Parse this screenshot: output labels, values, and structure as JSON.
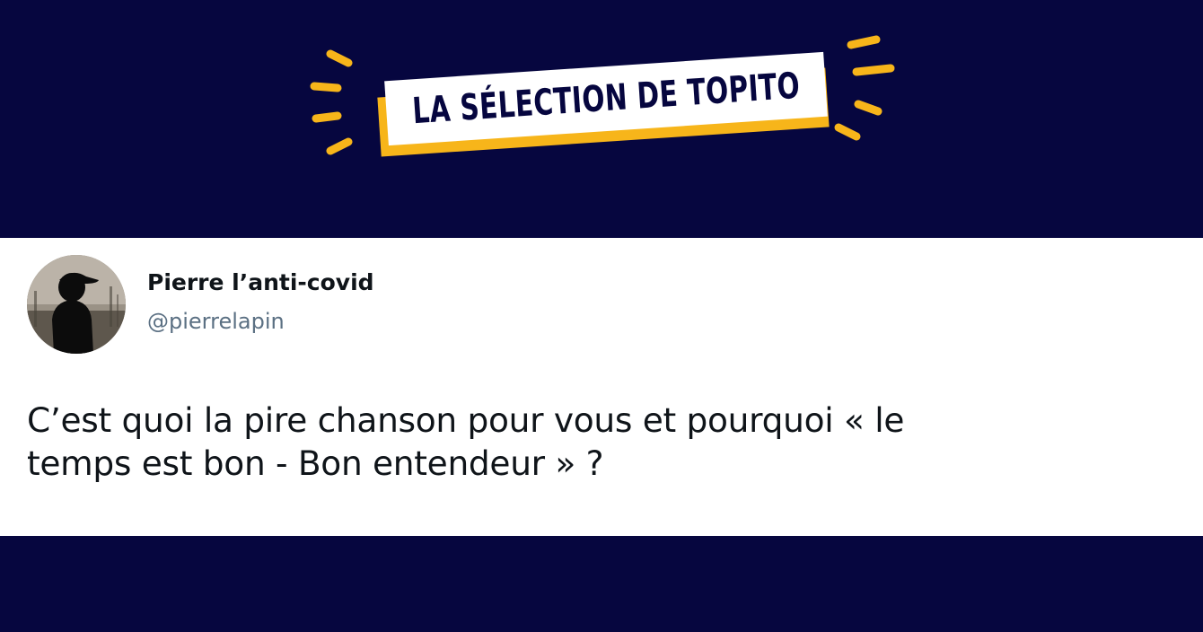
{
  "banner": {
    "title": "LA SÉLECTION DE TOPITO",
    "background_color": "#06063f",
    "accent_color": "#f7b51a",
    "rays_icon": "sparkle-rays"
  },
  "tweet": {
    "author": {
      "name": "Pierre l’anti-covid",
      "handle": "@pierrelapin",
      "avatar_icon": "profile-photo-silhouette"
    },
    "text_lines": [
      "C’est quoi la pire chanson pour vous et pourquoi « le",
      "temps est bon - Bon entendeur » ?"
    ]
  }
}
